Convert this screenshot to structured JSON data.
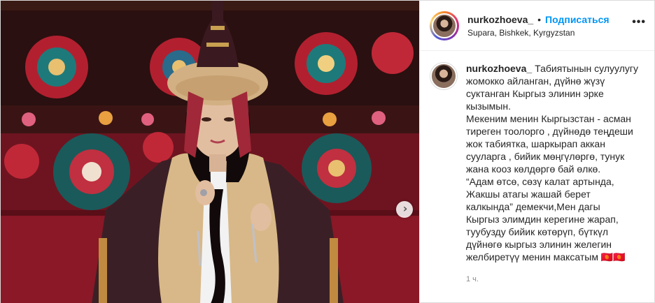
{
  "header": {
    "username": "nurkozhoeva_",
    "dot": "•",
    "follow_label": "Подписаться",
    "location": "Supara, Bishkek, Kyrgyzstan",
    "more_icon": "more-horizontal-icon",
    "more_glyph": "•••"
  },
  "photo": {
    "next_icon": "chevron-right-icon",
    "next_glyph": "›"
  },
  "caption": {
    "username": "nurkozhoeva_",
    "lines": [
      "Табиятынын сулуулугу",
      "жомокко айланган, дүйнө жүзү",
      "суктанган Кыргыз элинин эрке",
      "кызымын.",
      "Мекеним менин Кыргызстан - асман",
      "тиреген тоолорго , дүйнөдө теңдеши",
      "жок табиятка, шаркырап аккан",
      "сууларга , бийик мөңгүлөргө, тунук",
      "жана кооз көлдөргө бай өлкө.",
      "“Адам өтсө, сөзү калат артында,",
      "Жакшы атагы жашай берет",
      "калкында” демекчи,Мен дагы",
      "Кыргыз элимдин керегине жарап,",
      "туубузду бийик көтөрүп, бүткүл",
      "дүйнөгө кыргыз элинин желегин",
      "желбиретүү менин максатым 🇰🇬🇰🇬"
    ],
    "time": "1 ч."
  },
  "colors": {
    "accent": "#0095f6",
    "muted": "#8e8e8e",
    "text": "#262626"
  }
}
